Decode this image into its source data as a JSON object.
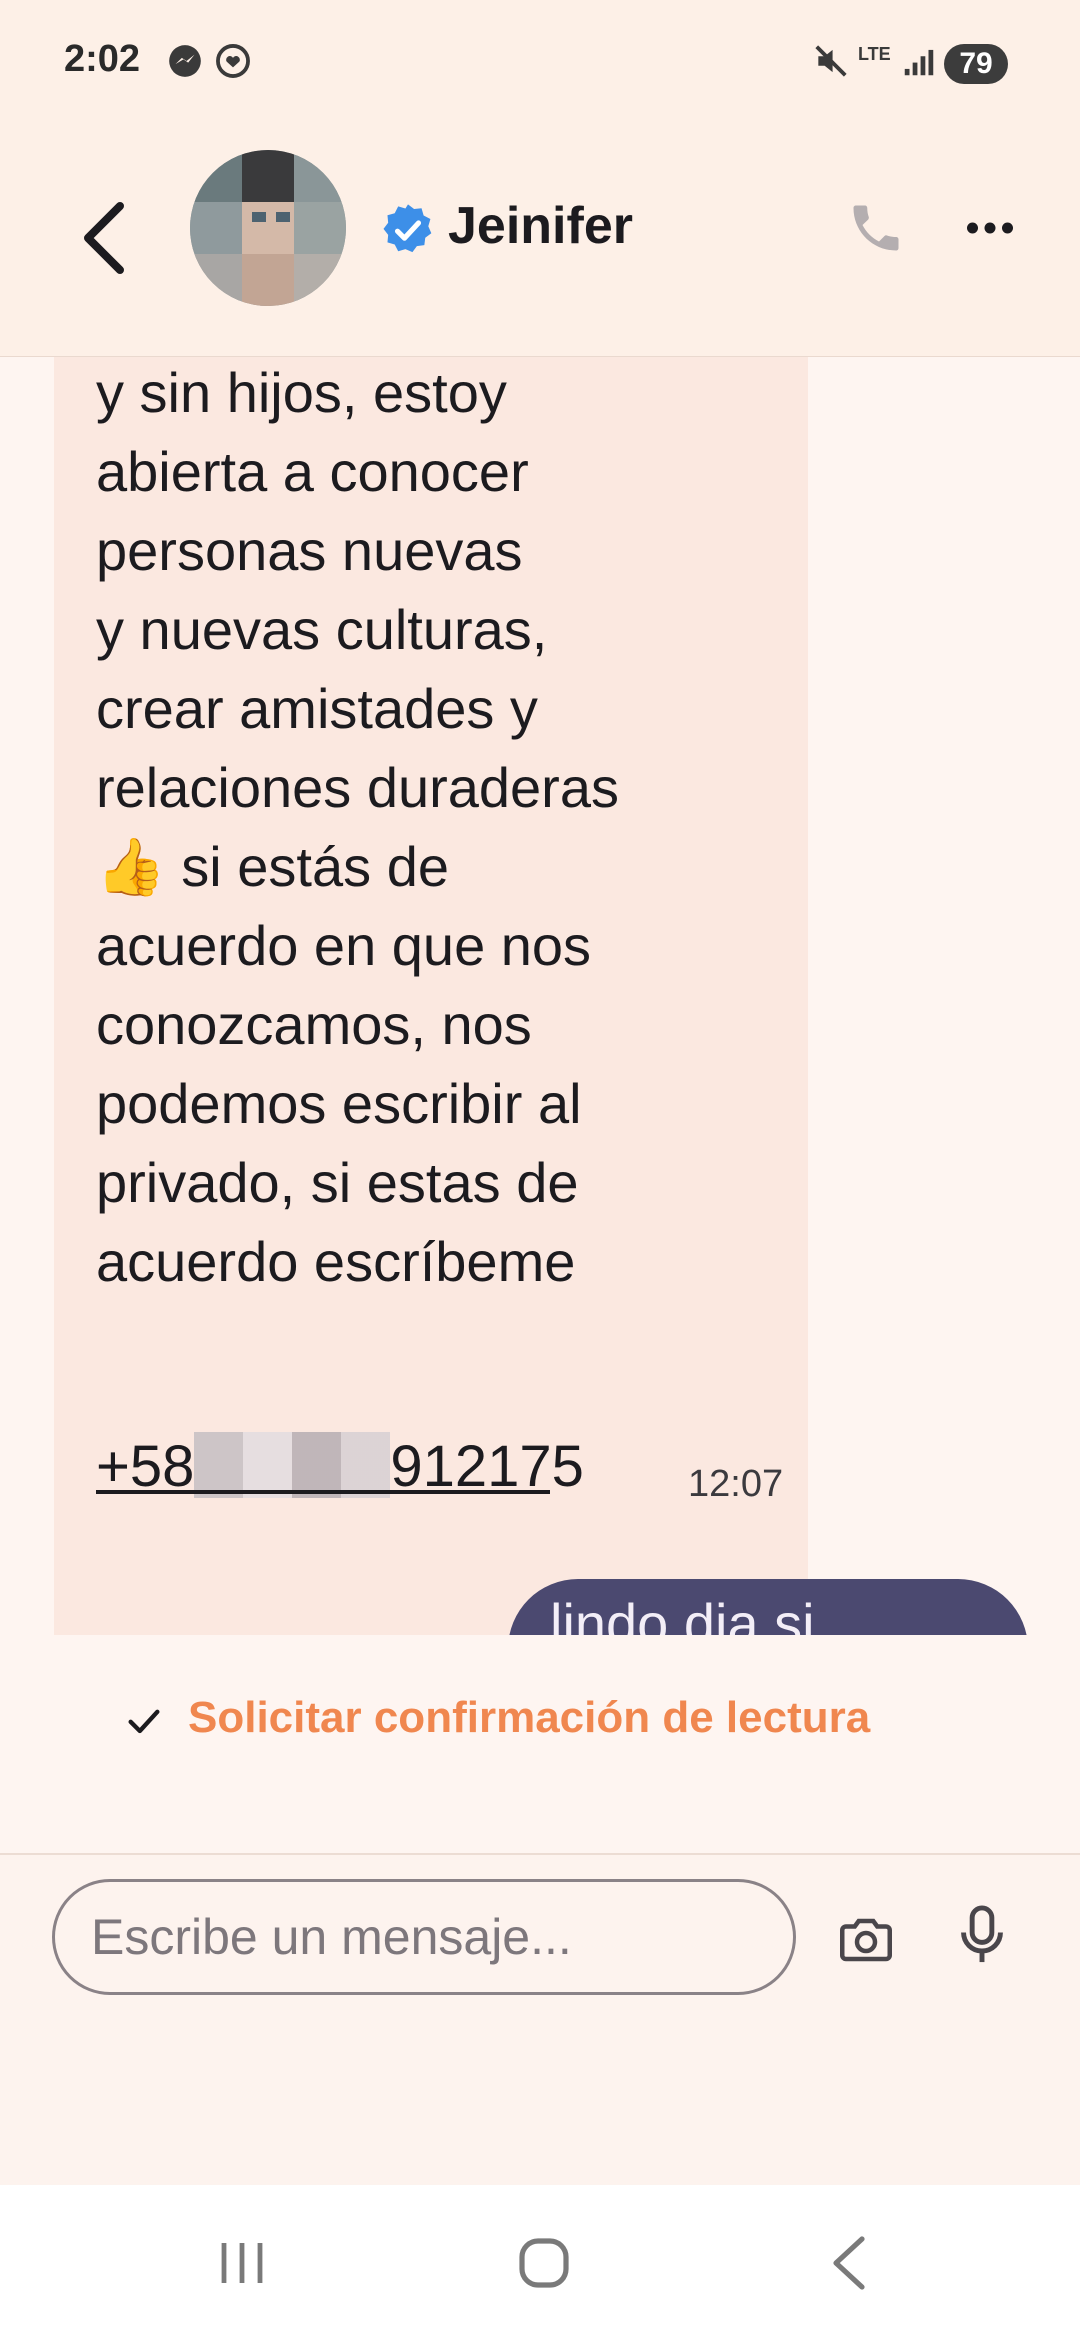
{
  "status_bar": {
    "time": "2:02",
    "network": "LTE",
    "battery": "79",
    "icons": [
      "messenger-icon",
      "chat-heart-icon",
      "mute-icon",
      "lte-icon",
      "signal-icon",
      "battery-icon"
    ]
  },
  "header": {
    "contact_name": "Jeinifer",
    "icons": [
      "back-icon",
      "verified-badge-icon",
      "phone-icon",
      "more-icon"
    ]
  },
  "messages": [
    {
      "direction": "incoming",
      "text": "conocer personas,\ntambién soy soltera\ny sin hijos, estoy\nabierta a conocer\npersonas nuevas\ny nuevas culturas,\ncrear amistades y\nrelaciones duraderas\n👍 si estás de\nacuerdo en que nos\nconozcamos, nos\npodemos escribir al\nprivado, si estas de\nacuerdo escríbeme",
      "phone_prefix": "+58",
      "phone_suffix": "912175",
      "time": "12:07"
    },
    {
      "direction": "outgoing",
      "text": "lindo dia si"
    }
  ],
  "read_receipt": {
    "label": "Solicitar confirmación de lectura"
  },
  "composer": {
    "placeholder": "Escribe un mensaje..."
  },
  "colors": {
    "accent": "#f0874f",
    "outgoing_bubble": "#4b4970",
    "incoming_bubble": "#fbe8e0",
    "verified": "#3d8fe8"
  }
}
